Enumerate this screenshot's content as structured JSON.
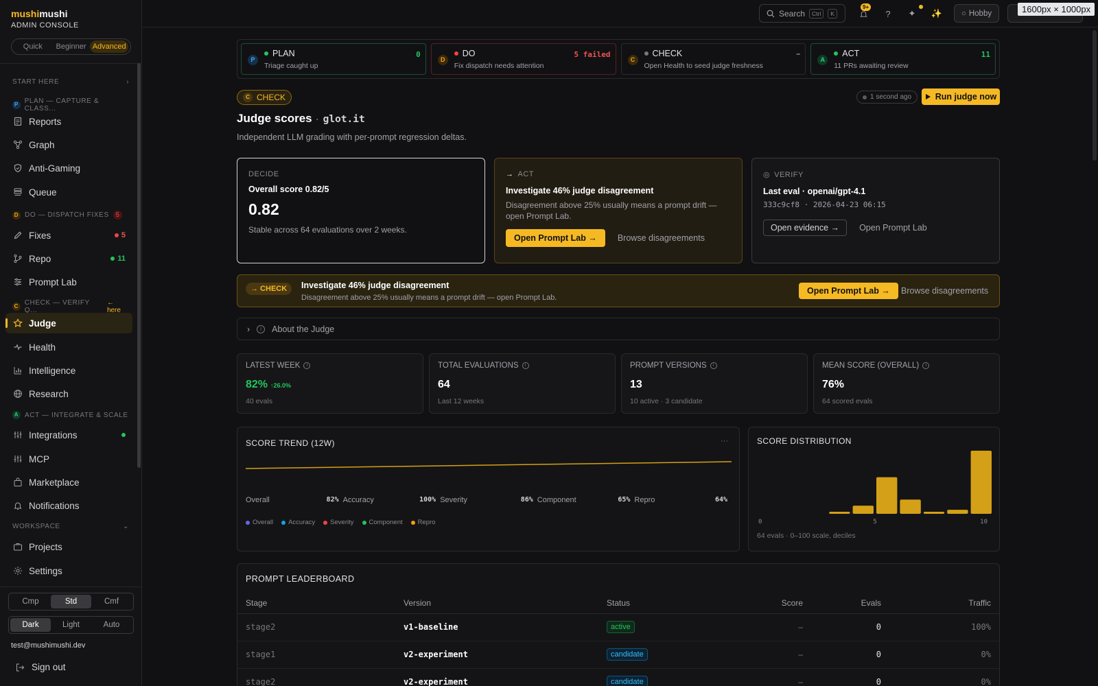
{
  "brand": {
    "part1": "mushi",
    "part2": "mushi",
    "subtitle": "ADMIN CONSOLE"
  },
  "levels": [
    "Quick",
    "Beginner",
    "Advanced"
  ],
  "sidebar": {
    "start_here": "START HERE",
    "plan_section": "PLAN — CAPTURE & CLASS...",
    "do_section": "DO — DISPATCH FIXES",
    "do_count": "5",
    "check_section": "CHECK — VERIFY Q...",
    "here_label": "← here",
    "act_section": "ACT — INTEGRATE & SCALE",
    "workspace_section": "WORKSPACE",
    "items": {
      "reports": "Reports",
      "graph": "Graph",
      "anti_gaming": "Anti-Gaming",
      "queue": "Queue",
      "fixes": "Fixes",
      "fixes_count": "5",
      "repo": "Repo",
      "repo_count": "11",
      "prompt_lab": "Prompt Lab",
      "judge": "Judge",
      "health": "Health",
      "intelligence": "Intelligence",
      "research": "Research",
      "integrations": "Integrations",
      "mcp": "MCP",
      "marketplace": "Marketplace",
      "notifications": "Notifications",
      "projects": "Projects",
      "settings": "Settings"
    },
    "density": [
      "Cmp",
      "Std",
      "Cmf"
    ],
    "theme": [
      "Dark",
      "Light",
      "Auto"
    ],
    "email": "test@mushimushi.dev",
    "sign_out": "Sign out"
  },
  "topbar": {
    "search_label": "Search",
    "kbd_ctrl": "Ctrl",
    "kbd_k": "K",
    "notif_badge": "9+",
    "help": "?",
    "plan_button": "Hobby",
    "dims_overlay": "1600px × 1000px"
  },
  "pdca": [
    {
      "letter": "P",
      "title": "PLAN",
      "sub": "Triage caught up",
      "count": "0"
    },
    {
      "letter": "D",
      "title": "DO",
      "sub": "Fix dispatch needs attention",
      "count": "5 failed"
    },
    {
      "letter": "C",
      "title": "CHECK",
      "sub": "Open Health to seed judge freshness",
      "count": "–"
    },
    {
      "letter": "A",
      "title": "ACT",
      "sub": "11 PRs awaiting review",
      "count": "11"
    }
  ],
  "header": {
    "stage_letter": "C",
    "stage_label": "CHECK",
    "updated": "1 second ago",
    "run_button": "Run judge now",
    "title": "Judge scores",
    "dot": "·",
    "project": "glot.it",
    "subtitle": "Independent LLM grading with per-prompt regression deltas."
  },
  "decide": {
    "label": "DECIDE",
    "heading": "Overall score 0.82/5",
    "value": "0.82",
    "body": "Stable across 64 evaluations over 2 weeks."
  },
  "act": {
    "label": "ACT",
    "heading": "Investigate 46% judge disagreement",
    "body": "Disagreement above 25% usually means a prompt drift — open Prompt Lab.",
    "primary": "Open Prompt Lab →",
    "secondary": "Browse disagreements"
  },
  "verify": {
    "label": "VERIFY",
    "heading": "Last eval · openai/gpt-4.1",
    "meta": "333c9cf8 · 2026-04-23 06:15",
    "primary": "Open evidence →",
    "secondary": "Open Prompt Lab"
  },
  "banner": {
    "tag": "→ CHECK",
    "title": "Investigate 46% judge disagreement",
    "body": "Disagreement above 25% usually means a prompt drift — open Prompt Lab.",
    "primary": "Open Prompt Lab →",
    "secondary": "Browse disagreements"
  },
  "about": {
    "label": "About the Judge"
  },
  "stats": [
    {
      "label": "LATEST WEEK",
      "value": "82%",
      "delta": "↑26.0%",
      "note": "40 evals"
    },
    {
      "label": "TOTAL EVALUATIONS",
      "value": "64",
      "delta": "",
      "note": "Last 12 weeks"
    },
    {
      "label": "PROMPT VERSIONS",
      "value": "13",
      "delta": "",
      "note": "10 active · 3 candidate"
    },
    {
      "label": "MEAN SCORE (OVERALL)",
      "value": "76%",
      "delta": "",
      "note": "64 scored evals"
    }
  ],
  "chart_data": [
    {
      "type": "line",
      "title": "SCORE TREND (12W)",
      "series_line_y_start": 0.8,
      "series_line_y_end": 0.82,
      "summary": [
        {
          "name": "Overall",
          "value": "82%"
        },
        {
          "name": "Accuracy",
          "value": "100%"
        },
        {
          "name": "Severity",
          "value": "86%"
        },
        {
          "name": "Component",
          "value": "65%"
        },
        {
          "name": "Repro",
          "value": "64%"
        }
      ],
      "legend": [
        {
          "name": "Overall",
          "color": "#6366f1"
        },
        {
          "name": "Accuracy",
          "color": "#0ea5e9"
        },
        {
          "name": "Severity",
          "color": "#ef4444"
        },
        {
          "name": "Component",
          "color": "#22c55e"
        },
        {
          "name": "Repro",
          "color": "#f59e0b"
        }
      ],
      "more": "···"
    },
    {
      "type": "bar",
      "title": "SCORE DISTRIBUTION",
      "x": [
        1,
        2,
        3,
        4,
        5,
        6,
        7,
        8,
        9,
        10
      ],
      "values": [
        0,
        0,
        0,
        1,
        4,
        18,
        7,
        1,
        2,
        31
      ],
      "ticks": [
        "0",
        "5",
        "10"
      ],
      "footnote": "64 evals · 0–100 scale, deciles",
      "color": "#d4a017"
    }
  ],
  "leaderboard": {
    "title": "PROMPT LEADERBOARD",
    "columns": [
      "Stage",
      "Version",
      "Status",
      "Score",
      "Evals",
      "Traffic"
    ],
    "rows": [
      {
        "stage": "stage2",
        "version": "v1-baseline",
        "status": "active",
        "score": "–",
        "evals": "0",
        "traffic": "100%"
      },
      {
        "stage": "stage1",
        "version": "v2-experiment",
        "status": "candidate",
        "score": "–",
        "evals": "0",
        "traffic": "0%"
      },
      {
        "stage": "stage2",
        "version": "v2-experiment",
        "status": "candidate",
        "score": "–",
        "evals": "0",
        "traffic": "0%"
      }
    ]
  }
}
